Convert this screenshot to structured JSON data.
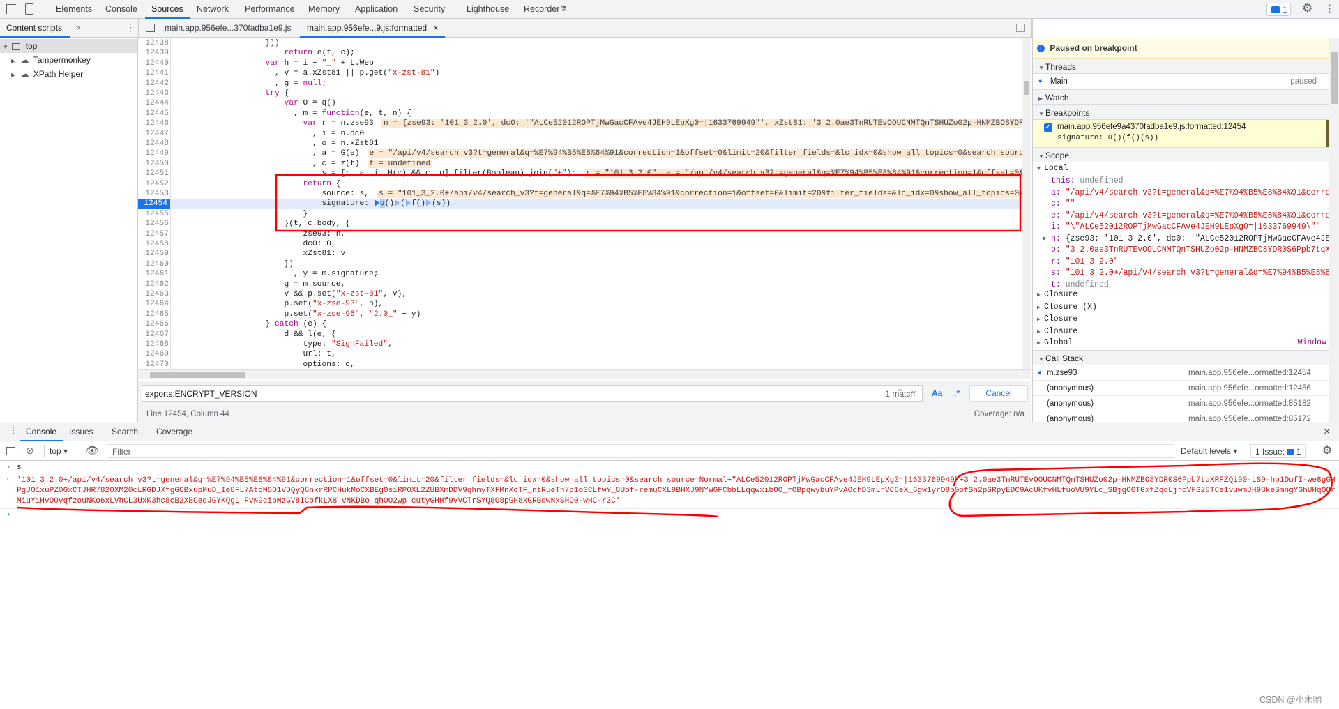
{
  "top_tabs": [
    "Elements",
    "Console",
    "Sources",
    "Network",
    "Performance",
    "Memory",
    "Application",
    "Security",
    "Lighthouse",
    "Recorder"
  ],
  "issues_badge": "1",
  "navigator": {
    "tab": "Content scripts",
    "more": "»",
    "tree": [
      "top",
      "Tampermonkey",
      "XPath Helper"
    ]
  },
  "file_tabs": [
    {
      "label": "main.app.956efe...370fadba1e9.js"
    },
    {
      "label": "main.app.956efe...9.js:formatted",
      "close": "×"
    }
  ],
  "code": [
    {
      "n": "12438",
      "t": [
        [
          "                  }))"
        ]
      ]
    },
    {
      "n": "12439",
      "t": [
        [
          "                      "
        ],
        [
          "return",
          "kw"
        ],
        [
          " e(t, c);"
        ]
      ]
    },
    {
      "n": "12440",
      "t": [
        [
          "                  "
        ],
        [
          "var",
          "kw"
        ],
        [
          " h = i + "
        ],
        [
          "\"_\"",
          "str"
        ],
        [
          " + L.Web"
        ]
      ]
    },
    {
      "n": "12441",
      "t": [
        [
          "                    , v = a.xZst81 || p.get("
        ],
        [
          "\"x-zst-81\"",
          "str"
        ],
        [
          ")"
        ]
      ]
    },
    {
      "n": "12442",
      "t": [
        [
          "                    , g = "
        ],
        [
          "null",
          "kw"
        ],
        [
          ";"
        ]
      ]
    },
    {
      "n": "12443",
      "t": [
        [
          "                  "
        ],
        [
          "try",
          "kw"
        ],
        [
          " {"
        ]
      ]
    },
    {
      "n": "12444",
      "t": [
        [
          "                      "
        ],
        [
          "var",
          "kw"
        ],
        [
          " O = q()"
        ]
      ]
    },
    {
      "n": "12445",
      "t": [
        [
          "                        , m = "
        ],
        [
          "function",
          "kw"
        ],
        [
          "(e, t, n) {"
        ]
      ]
    },
    {
      "n": "12446",
      "t": [
        [
          "                          "
        ],
        [
          "var",
          "kw"
        ],
        [
          " r = n.zse93"
        ]
      ],
      "v": "n = {zse93: '101_3_2.0', dc0: '\"ALCe52012ROPTjMwGacCFAve4JEH9LEpXg0=|1633769949\"', xZst81: '3_2.0ae3TnRUTEvOOUCNMTQnTSHUZo02p-HNMZBO8YDR0S6"
    },
    {
      "n": "12447",
      "t": [
        [
          "                            , i = n.dc0"
        ]
      ]
    },
    {
      "n": "12448",
      "t": [
        [
          "                            , o = n.xZst81"
        ]
      ]
    },
    {
      "n": "12449",
      "t": [
        [
          "                            , a = G(e)"
        ]
      ],
      "v": "e = \"/api/v4/search_v3?t=general&q=%E7%94%B5%E8%84%91&correction=1&offset=0&limit=20&filter_fields=&lc_idx=0&show_all_topics=0&search_source=N"
    },
    {
      "n": "12450",
      "t": [
        [
          "                            , c = z(t)"
        ]
      ],
      "v": "t = undefined"
    },
    {
      "n": "12451",
      "t": [
        [
          "                            , s = [r, a, i, H(c) && c, o].filter(Boolean).join("
        ],
        [
          "\"+\"",
          "str"
        ],
        [
          ");"
        ]
      ],
      "v": "r = \"101_3_2.0\", a = \"/api/v4/search_v3?t=general&q=%E7%94%B5%E8%84%91&correction=1&offset=0&li"
    },
    {
      "n": "12452",
      "t": [
        [
          "                          "
        ],
        [
          "return",
          "kw"
        ],
        [
          " {"
        ]
      ]
    },
    {
      "n": "12453",
      "t": [
        [
          "                              source: s,"
        ]
      ],
      "v": "s = \"101_3_2.0+/api/v4/search_v3?t=general&q=%E7%94%B5%E8%84%91&correction=1&offset=0&limit=20&filter_fields=&lc_idx=0&show_all_topics=0&sea"
    },
    {
      "n": "12454",
      "cur": true,
      "t": [
        [
          "                              signature: "
        ],
        [
          "",
          "bp on"
        ],
        [
          "u",
          "hl"
        ],
        [
          "()"
        ],
        [
          "",
          "bp"
        ],
        [
          "("
        ],
        [
          "",
          "bp"
        ],
        [
          "f()"
        ],
        [
          "",
          "bp"
        ],
        [
          "(s))"
        ]
      ]
    },
    {
      "n": "12455",
      "t": [
        [
          "                          }"
        ]
      ]
    },
    {
      "n": "12456",
      "t": [
        [
          "                      }(t, c.body, {"
        ]
      ]
    },
    {
      "n": "12457",
      "t": [
        [
          "                          zse93: h,"
        ]
      ]
    },
    {
      "n": "12458",
      "t": [
        [
          "                          dc0: O,"
        ]
      ]
    },
    {
      "n": "12459",
      "t": [
        [
          "                          xZst81: v"
        ]
      ]
    },
    {
      "n": "12460",
      "t": [
        [
          "                      })"
        ]
      ]
    },
    {
      "n": "12461",
      "t": [
        [
          "                        , y = m.signature;"
        ]
      ]
    },
    {
      "n": "12462",
      "t": [
        [
          "                      g = m.source,"
        ]
      ]
    },
    {
      "n": "12463",
      "t": [
        [
          "                      v && p.set("
        ],
        [
          "\"x-zst-81\"",
          "str"
        ],
        [
          ", v),"
        ]
      ]
    },
    {
      "n": "12464",
      "t": [
        [
          "                      p.set("
        ],
        [
          "\"x-zse-93\"",
          "str"
        ],
        [
          ", h),"
        ]
      ]
    },
    {
      "n": "12465",
      "t": [
        [
          "                      p.set("
        ],
        [
          "\"x-zse-96\"",
          "str"
        ],
        [
          ", "
        ],
        [
          "\"2.0_\"",
          "str"
        ],
        [
          " + y)"
        ]
      ]
    },
    {
      "n": "12466",
      "t": [
        [
          "                  } "
        ],
        [
          "catch",
          "kw"
        ],
        [
          " (e) {"
        ]
      ]
    },
    {
      "n": "12467",
      "t": [
        [
          "                      d && l(e, {"
        ]
      ]
    },
    {
      "n": "12468",
      "t": [
        [
          "                          type: "
        ],
        [
          "\"SignFailed\"",
          "str"
        ],
        [
          ","
        ]
      ]
    },
    {
      "n": "12469",
      "t": [
        [
          "                          url: t,"
        ]
      ]
    },
    {
      "n": "12470",
      "t": [
        [
          "                          options: c,"
        ]
      ]
    }
  ],
  "search": {
    "value": "exports.ENCRYPT_VERSION",
    "matches": "1 match",
    "case_label": "Aa",
    "regex_label": ".*",
    "cancel": "Cancel"
  },
  "status": {
    "position": "Line 12454, Column 44",
    "coverage": "Coverage: n/a"
  },
  "debugger": {
    "paused": "Paused on breakpoint",
    "threads": {
      "title": "Threads",
      "main": "Main",
      "state": "paused"
    },
    "watch": "Watch",
    "breakpoints": {
      "title": "Breakpoints",
      "file": "main.app.956efe9a4370fadba1e9.js:formatted:12454",
      "code": "signature: u()(f()(s))",
      "checked": true
    },
    "scope": {
      "title": "Scope",
      "local": "Local",
      "vars": [
        {
          "k": "this",
          "v": "undefined",
          "type": "undef"
        },
        {
          "k": "a",
          "v": "\"/api/v4/search_v3?t=general&q=%E7%94%B5%E8%84%91&correcti",
          "type": "str"
        },
        {
          "k": "c",
          "v": "\"\"",
          "type": "str"
        },
        {
          "k": "e",
          "v": "\"/api/v4/search_v3?t=general&q=%E7%94%B5%E8%84%91&correcti",
          "type": "str"
        },
        {
          "k": "i",
          "v": "\"\\\"ALCe52012ROPTjMwGacCFAve4JEH9LEpXg0=|1633769949\\\"\"",
          "type": "str"
        },
        {
          "k": "n",
          "v": "{zse93: '101_3_2.0', dc0: '\"ALCe52012ROPTjMwGacCFAve4JEH9L",
          "type": "obj"
        },
        {
          "k": "o",
          "v": "\"3_2.0ae3TnRUTEvOOUCNMTQnTSHUZo02p-HNMZBO8YDR0S6Ppb7tqXRF",
          "type": "str"
        },
        {
          "k": "r",
          "v": "\"101_3_2.0\"",
          "type": "str"
        },
        {
          "k": "s",
          "v": "\"101_3_2.0+/api/v4/search_v3?t=general&q=%E7%94%B5%E8%84%9",
          "type": "str"
        },
        {
          "k": "t",
          "v": "undefined",
          "type": "undef"
        }
      ],
      "closures": [
        "Closure",
        "Closure (X)",
        "Closure",
        "Closure"
      ],
      "global": "Global",
      "global_value": "Window"
    },
    "call_stack": {
      "title": "Call Stack",
      "frames": [
        {
          "fn": "m.zse93",
          "loc": "main.app.956efe...ormatted:12454",
          "current": true
        },
        {
          "fn": "(anonymous)",
          "loc": "main.app.956efe...ormatted:12456"
        },
        {
          "fn": "(anonymous)",
          "loc": "main.app.956efe...ormatted:85182"
        },
        {
          "fn": "(anonymous)",
          "loc": "main.app.956efe...ormatted:85172"
        }
      ]
    }
  },
  "drawer": {
    "tabs": [
      "Console",
      "Issues",
      "Search",
      "Coverage"
    ],
    "close": "×"
  },
  "console_toolbar": {
    "context": "top ▾",
    "filter_placeholder": "Filter",
    "levels": "Default levels ▾",
    "issues": "1 Issue:",
    "issues_count": "1"
  },
  "console": {
    "input": "s",
    "output": [
      "'101_3_2.0+/api/v4/search_v3?t=general&q=%E7%94%B5%E8%84%91&correction=1&offset=0&limit=20&filter_fields=&lc_idx=0&show_all_topics=0&search_source=Normal+\"ALCe52012ROPTjMwGacCFAve4JEH9LEpXg0=|1633769949\"+3_2.0ae3TnRUTEvOOUCNMTQnTSHUZo02p-HNMZBO8YDR0S6Ppb7tqXRFZQi90-LS9-hp1DufI-we8gGH",
      "PgJO1xuPZ0GxCTJHR7820XM20cLRGDJXfgGCBxupMuD_Ie8FL7AtqM6O1VDQyQ6nxrRPCHukMoCXBEgOsiRP0XL2ZUBXmDDV9qhnyTXFMnXcTF_ntRueTh7p1o0CLfwY_8Uof-remuCXL9BHXJ9NYWGFCbbLLqqwxibOO_rOBpqwybuYPvAOqfD3mLrVC6eX_6gw1yrO8b0ofSh2pSRpyEDC9AcUKfvHLfuoVU9YLc_SBjgOOTGxfZqoLjrcVFG28TCe1vuwmJH98keSmngYGhUHqQQr",
      "MiuY1HvO0vqfzouNKo6xLVhCL3UxK3hc8cB2XBCeqJGYKQgL_FvN9cipMzGV8ICofkLX8_vNKDBo_qhOO2wp_cutyGHHf9vVCTrSYQ8O8pGH8xGRBqwNxSHO0-wHC-r3C'"
    ]
  },
  "watermark": "CSDN @小木哟",
  "colors": {
    "accent": "#1a73e8",
    "annotation": "#ff0000",
    "string": "#c41a16",
    "keyword": "#aa0d91"
  }
}
